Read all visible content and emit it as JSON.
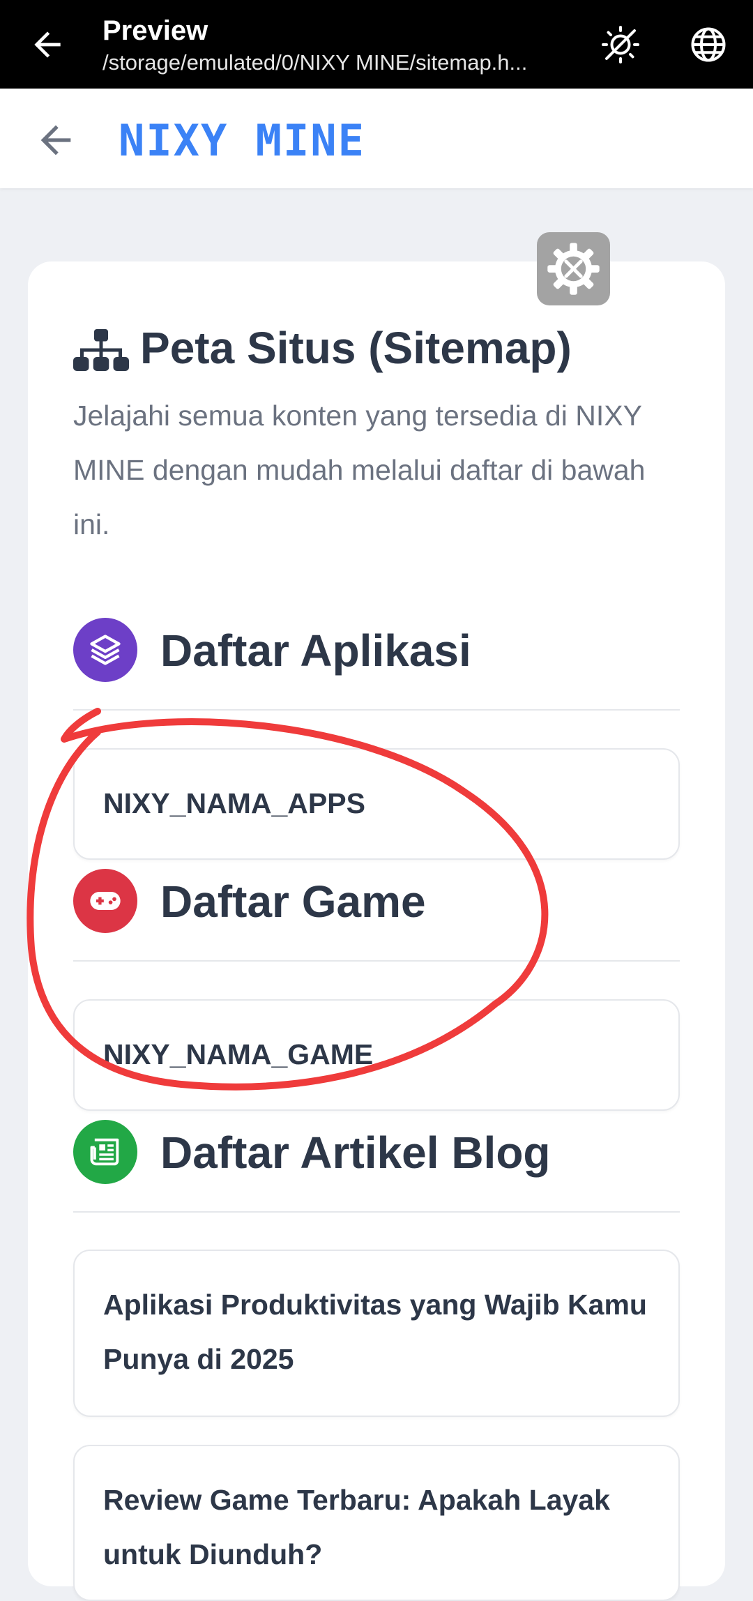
{
  "topbar": {
    "title": "Preview",
    "path": "/storage/emulated/0/NIXY MINE/sitemap.h...",
    "back_icon": "arrow-left-icon",
    "theme_icon": "theme-toggle-off-icon",
    "browser_icon": "globe-icon"
  },
  "appbar": {
    "brand": "NIXY MINE",
    "brand_color": "#3b82f6",
    "back_icon": "arrow-left-icon"
  },
  "settings_icon": "gear-wrench-icon",
  "page": {
    "title": "Peta Situs (Sitemap)",
    "title_icon": "sitemap-icon",
    "intro": "Jelajahi semua konten yang tersedia di NIXY MINE dengan mudah melalui daftar di bawah ini."
  },
  "sections": {
    "apps": {
      "label": "Daftar Aplikasi",
      "icon": "layers-icon",
      "color": "#6d3fc7",
      "items": [
        "NIXY_NAMA_APPS"
      ]
    },
    "games": {
      "label": "Daftar Game",
      "icon": "gamepad-icon",
      "color": "#dc3545",
      "items": [
        "NIXY_NAMA_GAME"
      ]
    },
    "blog": {
      "label": "Daftar Artikel Blog",
      "icon": "newspaper-icon",
      "color": "#22a846",
      "items": [
        "Aplikasi Produktivitas yang Wajib Kamu Punya di 2025",
        "Review Game Terbaru: Apakah Layak untuk Diunduh?"
      ]
    }
  },
  "annotation_color": "#ef3b3b"
}
